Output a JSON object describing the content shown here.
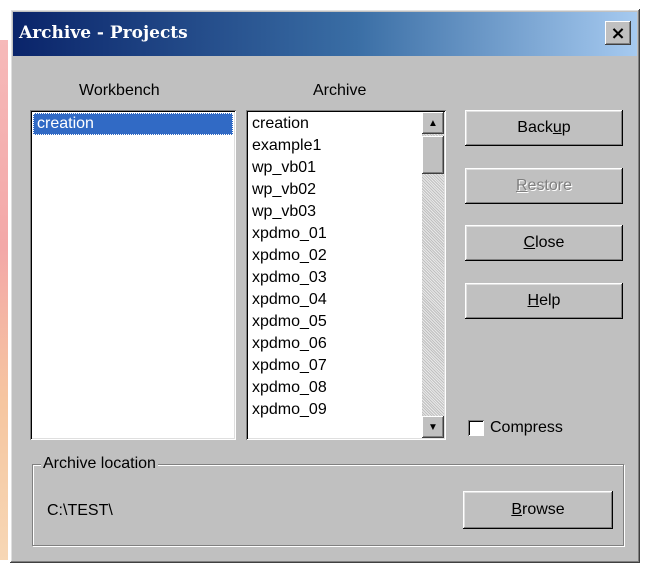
{
  "window": {
    "title": "Archive - Projects",
    "close_glyph": "×"
  },
  "workbench": {
    "label": "Workbench",
    "items": [
      "creation"
    ]
  },
  "archive": {
    "label": "Archive",
    "items": [
      "creation",
      "example1",
      "wp_vb01",
      "wp_vb02",
      "wp_vb03",
      "xpdmo_01",
      "xpdmo_02",
      "xpdmo_03",
      "xpdmo_04",
      "xpdmo_05",
      "xpdmo_06",
      "xpdmo_07",
      "xpdmo_08",
      "xpdmo_09"
    ]
  },
  "buttons": {
    "backup": {
      "pre": "Back",
      "mn": "u",
      "post": "p"
    },
    "restore": {
      "pre": "",
      "mn": "R",
      "post": "estore"
    },
    "close": {
      "pre": "",
      "mn": "C",
      "post": "lose"
    },
    "help": {
      "pre": "",
      "mn": "H",
      "post": "elp"
    },
    "browse": {
      "pre": "",
      "mn": "B",
      "post": "rowse"
    }
  },
  "compress": {
    "label": "Compress",
    "checked": false
  },
  "location": {
    "group_label": "Archive location",
    "path": "C:\\TEST\\"
  },
  "icons": {
    "scroll_up": "▲",
    "scroll_down": "▼"
  }
}
